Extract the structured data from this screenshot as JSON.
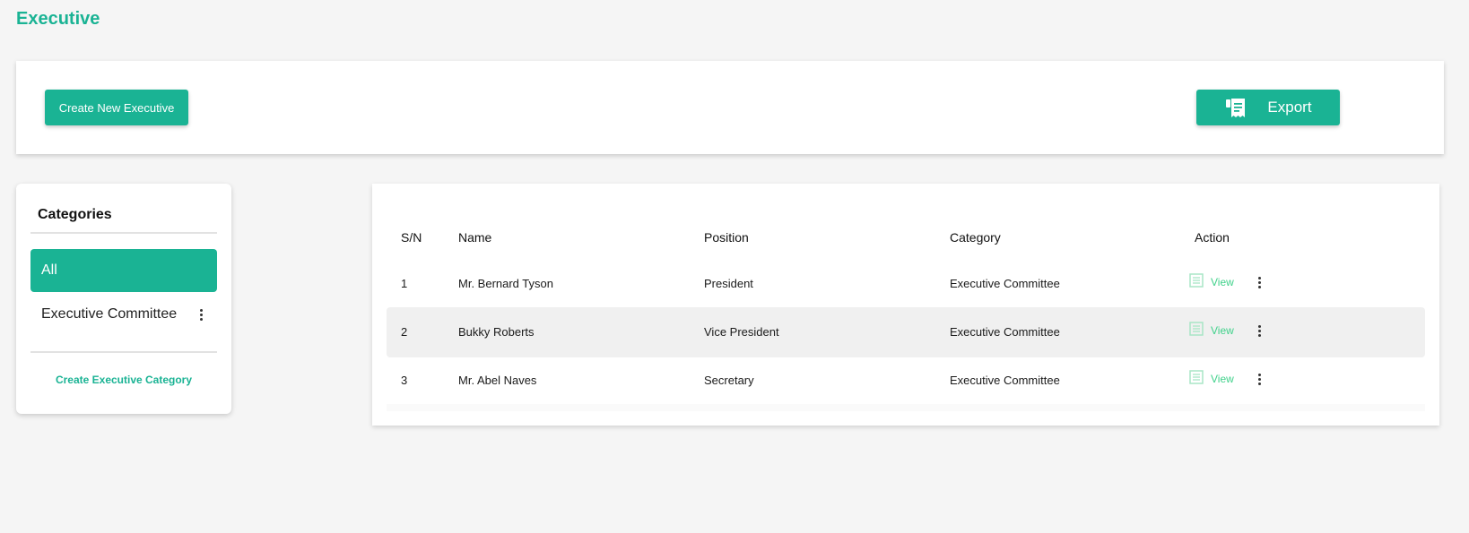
{
  "page": {
    "title": "Executive"
  },
  "toolbar": {
    "create_label": "Create New Executive",
    "export_label": "Export",
    "export_icon": "receipt-icon"
  },
  "categories": {
    "heading": "Categories",
    "items": [
      {
        "label": "All",
        "active": true
      },
      {
        "label": "Executive Committee",
        "active": false
      }
    ],
    "create_link": "Create Executive Category"
  },
  "table": {
    "columns": [
      "S/N",
      "Name",
      "Position",
      "Category",
      "Action"
    ],
    "rows": [
      {
        "sn": "1",
        "name": "Mr. Bernard Tyson",
        "position": "President",
        "category": "Executive Committee",
        "action": "View"
      },
      {
        "sn": "2",
        "name": "Bukky Roberts",
        "position": "Vice President",
        "category": "Executive Committee",
        "action": "View"
      },
      {
        "sn": "3",
        "name": "Mr. Abel Naves",
        "position": "Secretary",
        "category": "Executive Committee",
        "action": "View"
      }
    ]
  },
  "colors": {
    "accent": "#1ab394",
    "view_link": "#3fd18a",
    "row_highlight": "#f0f0f0",
    "background": "#f5f5f5"
  }
}
